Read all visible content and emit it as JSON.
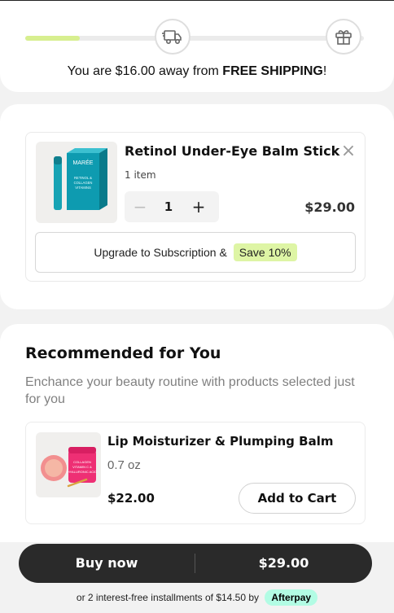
{
  "shipping": {
    "progress_fraction": 0.16,
    "message_prefix": "You are $16.00 away from ",
    "message_bold": "FREE SHIPPING",
    "message_suffix": "!"
  },
  "cart_item": {
    "title": "Retinol Under-Eye Balm Stick",
    "count_text": "1 item",
    "quantity": "1",
    "price": "$29.00",
    "package_brand": "MARÉE",
    "package_text": "RETINOL & COLLAGEN VITAMINS",
    "subscription_label": "Upgrade to Subscription &",
    "save_badge": "Save 10%"
  },
  "recommendations": {
    "title": "Recommended for You",
    "subtitle": "Enchance your beauty routine with products selected just for you",
    "items": [
      {
        "name": "Lip Moisturizer & Plumping Balm",
        "size": "0.7 oz",
        "price": "$22.00",
        "button": "Add to Cart",
        "jar_text": "COLLAGEN VITAMIN C & HYALURONIC ACID"
      }
    ]
  },
  "checkout": {
    "buy_label": "Buy now",
    "total": "$29.00",
    "installments_text": "or 2 interest-free installments of $14.50 by",
    "afterpay_label": "Afterpay"
  },
  "colors": {
    "progress_fill": "#d7ef8f",
    "save_badge_bg": "#def5a5",
    "afterpay_badge_bg": "#b2fce4",
    "buy_bar_bg": "#2a2a2a"
  },
  "icons": [
    "truck-icon",
    "gift-icon",
    "close-icon",
    "minus-icon",
    "plus-icon"
  ]
}
